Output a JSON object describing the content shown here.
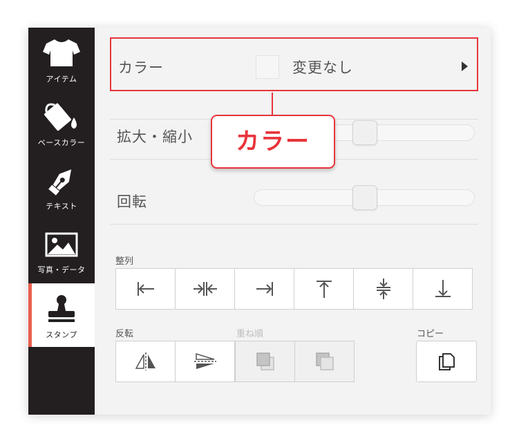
{
  "sidebar": {
    "items": [
      {
        "label": "アイテム",
        "icon": "tshirt-icon"
      },
      {
        "label": "ベースカラー",
        "icon": "paint-bucket-icon"
      },
      {
        "label": "テキスト",
        "icon": "pen-nib-icon"
      },
      {
        "label": "写真・データ",
        "icon": "image-icon"
      },
      {
        "label": "スタンプ",
        "icon": "stamp-icon",
        "active": true
      }
    ]
  },
  "color": {
    "label": "カラー",
    "value": "変更なし"
  },
  "scale": {
    "label": "拡大・縮小",
    "value_fraction": 0.5
  },
  "rotate": {
    "label": "回転",
    "value_fraction": 0.5
  },
  "callout": {
    "text": "カラー"
  },
  "align": {
    "label": "整列",
    "buttons": [
      "align-left-icon",
      "align-center-horizontal-icon",
      "align-right-icon",
      "align-top-icon",
      "align-center-vertical-icon",
      "align-bottom-icon"
    ]
  },
  "flip": {
    "label": "反転",
    "buttons": [
      "flip-horizontal-icon",
      "flip-vertical-icon"
    ]
  },
  "order": {
    "label": "重ね順",
    "disabled": true,
    "buttons": [
      "bring-forward-icon",
      "send-backward-icon"
    ]
  },
  "copy": {
    "label": "コピー",
    "icon": "copy-icon"
  },
  "colors": {
    "sidebar_bg": "#231f20",
    "accent_red": "#e8343b",
    "active_marker": "#ea5e4f",
    "panel_bg": "#f3f3f3"
  }
}
